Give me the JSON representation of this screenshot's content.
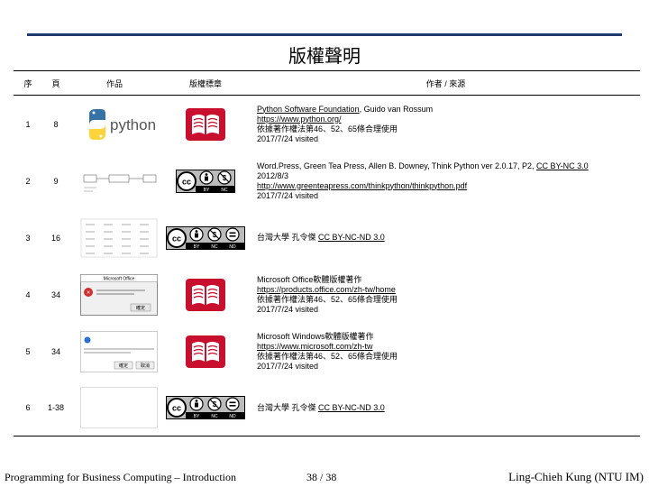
{
  "title": "版權聲明",
  "columns": [
    "序",
    "頁",
    "作品",
    "版權標章",
    "作者 / 來源"
  ],
  "rows": [
    {
      "seq": "1",
      "page": "8",
      "work_icon": "python-logo-icon",
      "license_icon": "copyright-book-icon",
      "lines": [
        {
          "parts": [
            {
              "text": "Python Software Foundation",
              "link": true
            },
            {
              "text": ", Guido van Rossum",
              "link": false
            }
          ]
        },
        {
          "parts": [
            {
              "text": "https://www.python.org/",
              "link": true
            }
          ]
        },
        {
          "parts": [
            {
              "text": "依據著作權法第46、52、65條合理使用",
              "link": false
            }
          ]
        },
        {
          "parts": [
            {
              "text": "2017/7/24 visited",
              "link": false
            }
          ]
        }
      ]
    },
    {
      "seq": "2",
      "page": "9",
      "work_icon": "diagram-thumbnail-icon",
      "license_icon": "cc-by-nc-icon",
      "lines": [
        {
          "parts": [
            {
              "text": "Word.Press, Green Tea Press, Allen B. Downey, Think Python ver 2.0.17, P2, ",
              "link": false
            },
            {
              "text": "CC BY-NC 3.0",
              "link": true
            }
          ]
        },
        {
          "parts": [
            {
              "text": "2012/8/3",
              "link": false
            }
          ]
        },
        {
          "parts": [
            {
              "text": "http://www.greenteapress.com/thinkpython/thinkpython.pdf",
              "link": true
            }
          ]
        },
        {
          "parts": [
            {
              "text": "2017/7/24 visited",
              "link": false
            }
          ]
        }
      ]
    },
    {
      "seq": "3",
      "page": "16",
      "work_icon": "table-thumbnail-icon",
      "license_icon": "cc-by-nc-nd-icon",
      "lines": [
        {
          "parts": [
            {
              "text": "台灣大學 孔令傑 ",
              "link": false
            },
            {
              "text": "CC BY-NC-ND 3.0",
              "link": true
            }
          ]
        }
      ]
    },
    {
      "seq": "4",
      "page": "34",
      "work_icon": "office-error-dialog-thumbnail",
      "license_icon": "copyright-book-icon",
      "lines": [
        {
          "parts": [
            {
              "text": "Microsoft Office軟體版權著作",
              "link": false
            }
          ]
        },
        {
          "parts": [
            {
              "text": "https://products.office.com/zh-tw/home",
              "link": true
            }
          ]
        },
        {
          "parts": [
            {
              "text": "依據著作權法第46、52、65條合理使用",
              "link": false
            }
          ]
        },
        {
          "parts": [
            {
              "text": "2017/7/24 visited",
              "link": false
            }
          ]
        }
      ]
    },
    {
      "seq": "5",
      "page": "34",
      "work_icon": "windows-dialog-thumbnail",
      "license_icon": "copyright-book-icon",
      "lines": [
        {
          "parts": [
            {
              "text": "Microsoft Windows軟體版權著作",
              "link": false
            }
          ]
        },
        {
          "parts": [
            {
              "text": "https://www.microsoft.com/zh-tw",
              "link": true
            }
          ]
        },
        {
          "parts": [
            {
              "text": "依據著作權法第46、52、65條合理使用",
              "link": false
            }
          ]
        },
        {
          "parts": [
            {
              "text": "2017/7/24 visited",
              "link": false
            }
          ]
        }
      ]
    },
    {
      "seq": "6",
      "page": "1-38",
      "work_icon": "blank-thumbnail",
      "license_icon": "cc-by-nc-nd-icon",
      "lines": [
        {
          "parts": [
            {
              "text": "台灣大學 孔令傑 ",
              "link": false
            },
            {
              "text": "CC BY-NC-ND 3.0",
              "link": true
            }
          ]
        }
      ]
    }
  ],
  "footer": {
    "left": "Programming for Business Computing – Introduction",
    "page": "38 / 38",
    "right": "Ling-Chieh Kung (NTU IM)"
  },
  "colors": {
    "rule": "#1e3a6e",
    "book": "#c8102e"
  },
  "thumb_text": {
    "python": "python",
    "office_title": "Microsoft Office",
    "office_button": "確定",
    "win_button1": "確定",
    "win_button2": "取消"
  }
}
